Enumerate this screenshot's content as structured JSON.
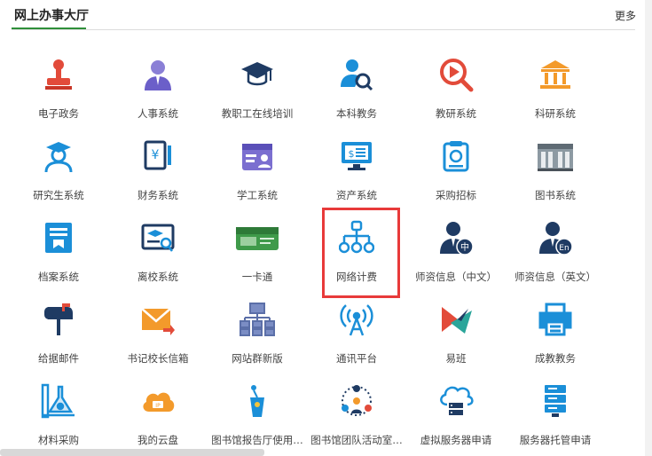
{
  "header": {
    "title": "网上办事大厅",
    "more": "更多"
  },
  "tiles": [
    {
      "label": "电子政务",
      "icon": "stamp-icon"
    },
    {
      "label": "人事系统",
      "icon": "person-suit-icon"
    },
    {
      "label": "教职工在线培训",
      "icon": "graduation-cap-icon"
    },
    {
      "label": "本科教务",
      "icon": "user-search-icon"
    },
    {
      "label": "教研系统",
      "icon": "play-search-icon"
    },
    {
      "label": "科研系统",
      "icon": "bank-building-icon"
    },
    {
      "label": "研究生系统",
      "icon": "student-icon"
    },
    {
      "label": "财务系统",
      "icon": "finance-document-icon"
    },
    {
      "label": "学工系统",
      "icon": "calendar-person-icon"
    },
    {
      "label": "资产系统",
      "icon": "monitor-asset-icon"
    },
    {
      "label": "采购招标",
      "icon": "purchase-document-icon"
    },
    {
      "label": "图书系统",
      "icon": "library-building-icon"
    },
    {
      "label": "档案系统",
      "icon": "archive-folder-icon"
    },
    {
      "label": "离校系统",
      "icon": "graduate-card-icon"
    },
    {
      "label": "一卡通",
      "icon": "campus-card-icon"
    },
    {
      "label": "网络计费",
      "icon": "network-tree-icon"
    },
    {
      "label": "师资信息（中文）",
      "icon": "teacher-zh-icon"
    },
    {
      "label": "师资信息（英文）",
      "icon": "teacher-en-icon"
    },
    {
      "label": "给据邮件",
      "icon": "mailbox-icon"
    },
    {
      "label": "书记校长信箱",
      "icon": "mail-forward-icon"
    },
    {
      "label": "网站群新版",
      "icon": "website-cluster-icon"
    },
    {
      "label": "通讯平台",
      "icon": "antenna-icon"
    },
    {
      "label": "易班",
      "icon": "yiban-logo-icon"
    },
    {
      "label": "成教教务",
      "icon": "printer-icon"
    },
    {
      "label": "材料采购",
      "icon": "flask-icon"
    },
    {
      "label": "我的云盘",
      "icon": "cloud-disk-icon"
    },
    {
      "label": "图书馆报告厅使用…",
      "icon": "microphone-stand-icon"
    },
    {
      "label": "图书馆团队活动室…",
      "icon": "team-room-icon"
    },
    {
      "label": "虚拟服务器申请",
      "icon": "cloud-server-icon"
    },
    {
      "label": "服务器托管申请",
      "icon": "server-rack-icon"
    }
  ],
  "colors": {
    "accent": "#2f8f3a",
    "highlight": "#e83a3a",
    "blue": "#1b8fd8",
    "navy": "#1f3b63",
    "red": "#e24b3a",
    "orange": "#f39a2b"
  }
}
